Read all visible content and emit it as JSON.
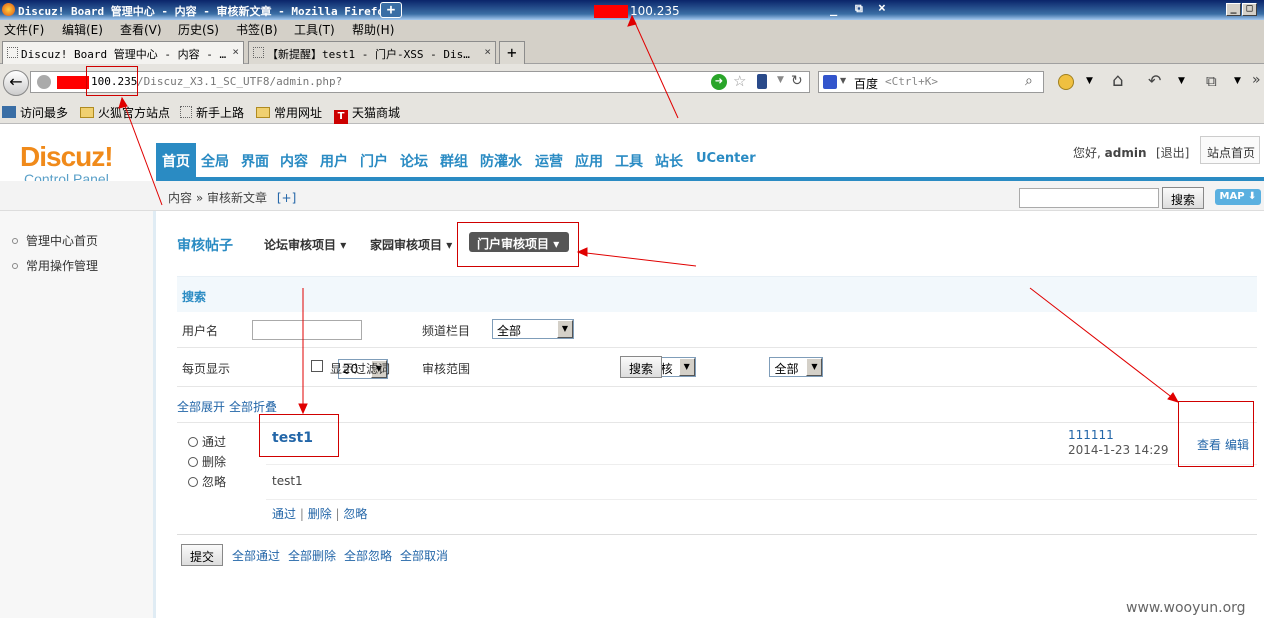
{
  "window": {
    "title": "Discuz! Board 管理中心 - 内容 - 审核新文章 - Mozilla Firefox",
    "ip": "100.235",
    "controls": [
      "_",
      "□",
      "×"
    ],
    "inner_controls": [
      "_",
      "⧉",
      "×"
    ]
  },
  "menu": [
    "文件(F)",
    "编辑(E)",
    "查看(V)",
    "历史(S)",
    "书签(B)",
    "工具(T)",
    "帮助(H)"
  ],
  "tabs": [
    {
      "label": "Discuz! Board 管理中心 - 内容 - …",
      "active": true
    },
    {
      "label": "【新提醒】test1 - 门户-XSS - Dis…",
      "active": false
    }
  ],
  "address": {
    "ip": "100.235",
    "path": "/Discuz_X3.1_SC_UTF8/admin.php?"
  },
  "search": {
    "engine": "百度",
    "placeholder": "<Ctrl+K>"
  },
  "bookmarks": [
    "访问最多",
    "火狐官方站点",
    "新手上路",
    "常用网址",
    "天猫商城"
  ],
  "header": {
    "logo": "Discuz!",
    "sub": "Control Panel",
    "greeting": "您好,",
    "user": "admin",
    "logout": "[退出]",
    "site_home": "站点首页"
  },
  "topnav": [
    "首页",
    "全局",
    "界面",
    "内容",
    "用户",
    "门户",
    "论坛",
    "群组",
    "防灌水",
    "运营",
    "应用",
    "工具",
    "站长",
    "UCenter"
  ],
  "breadcrumb": {
    "a": "内容",
    "sep": "»",
    "b": "审核新文章",
    "plus": "[+]"
  },
  "search_btn": "搜索",
  "map_btn": "MAP",
  "sidebar": [
    "管理中心首页",
    "常用操作管理"
  ],
  "subtabs": {
    "title": "审核帖子",
    "forum": "论坛审核项目",
    "home": "家园审核项目",
    "portal": "门户审核项目"
  },
  "form": {
    "section": "搜索",
    "username_label": "用户名",
    "channel_label": "频道栏目",
    "channel_value": "全部",
    "perpage_label": "每页显示",
    "perpage_value": "20",
    "filter_label": "显示过滤词",
    "scope_label": "审核范围",
    "scope_value": "未审核",
    "scope2_value": "全部",
    "search_button": "搜索"
  },
  "expand": {
    "all_open": "全部展开",
    "all_fold": "全部折叠"
  },
  "item": {
    "title": "test1",
    "options": [
      "通过",
      "删除",
      "忽略"
    ],
    "author": "111111",
    "time": "2014-1-23 14:29",
    "view": "查看",
    "edit": "编辑",
    "body": "test1",
    "actions": [
      "通过",
      "删除",
      "忽略"
    ]
  },
  "footer": {
    "submit": "提交",
    "pass_all": "全部通过",
    "delete_all": "全部删除",
    "ignore_all": "全部忽略",
    "cancel_all": "全部取消"
  },
  "watermark": "www.wooyun.org"
}
